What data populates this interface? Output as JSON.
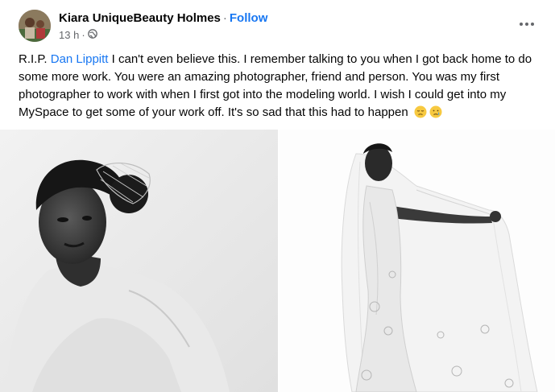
{
  "post": {
    "author_name": "Kiara UniqueBeauty Holmes",
    "separator": "·",
    "follow_label": "Follow",
    "timestamp": "13 h",
    "time_separator": "·",
    "audience_icon": "globe-icon",
    "more_icon": "more-options-icon",
    "body": {
      "prefix": "R.I.P. ",
      "mention": "Dan Lippitt",
      "text": "  I can't even believe this. I remember talking to you when I got back home to do some more work. You were an amazing photographer, friend and person. You was my first photographer to work with when I first got into the modeling world. I wish I could get into my MySpace to get some of your work off. It's so sad that this had to happen ",
      "emojis": [
        "disappointed-face-emoji",
        "crying-face-emoji"
      ]
    },
    "photos": [
      {
        "icon": "photo-portrait-bridal-veil"
      },
      {
        "icon": "photo-bride-wedding-gown"
      }
    ]
  },
  "colors": {
    "link": "#1877f2",
    "secondary_text": "#65676b",
    "primary_text": "#050505"
  }
}
